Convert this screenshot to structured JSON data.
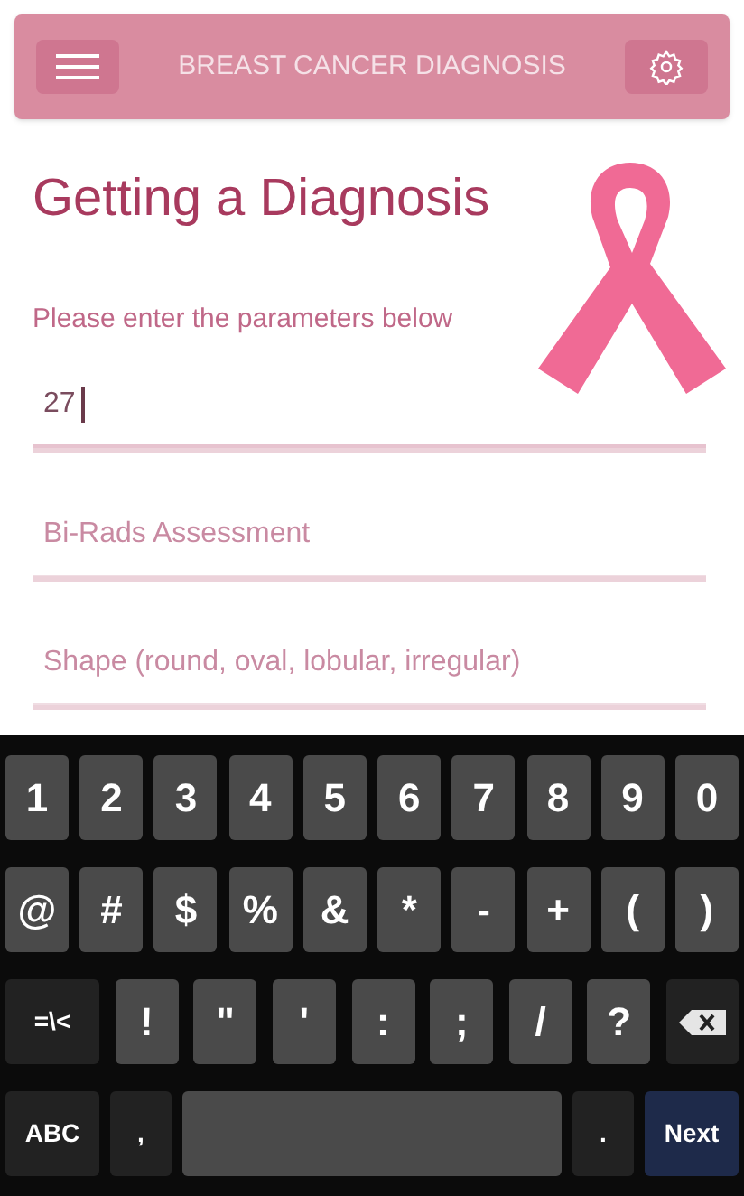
{
  "header": {
    "title": "BREAST CANCER DIAGNOSIS"
  },
  "page": {
    "heading": "Getting a Diagnosis",
    "instructions": "Please enter the parameters below"
  },
  "fields": [
    {
      "value": "27",
      "focused": true
    },
    {
      "placeholder": "Bi-Rads Assessment",
      "focused": false
    },
    {
      "placeholder": "Shape (round, oval, lobular, irregular)",
      "focused": false
    }
  ],
  "keyboard": {
    "rows": [
      {
        "keys": [
          {
            "kind": "char",
            "label": "1"
          },
          {
            "kind": "char",
            "label": "2"
          },
          {
            "kind": "char",
            "label": "3"
          },
          {
            "kind": "char",
            "label": "4"
          },
          {
            "kind": "char",
            "label": "5"
          },
          {
            "kind": "char",
            "label": "6"
          },
          {
            "kind": "char",
            "label": "7"
          },
          {
            "kind": "char",
            "label": "8"
          },
          {
            "kind": "char",
            "label": "9"
          },
          {
            "kind": "char",
            "label": "0"
          }
        ]
      },
      {
        "keys": [
          {
            "kind": "char",
            "label": "@"
          },
          {
            "kind": "char",
            "label": "#"
          },
          {
            "kind": "char",
            "label": "$"
          },
          {
            "kind": "char",
            "label": "%"
          },
          {
            "kind": "char",
            "label": "&"
          },
          {
            "kind": "char",
            "label": "*"
          },
          {
            "kind": "char",
            "label": "-"
          },
          {
            "kind": "char",
            "label": "+"
          },
          {
            "kind": "char",
            "label": "("
          },
          {
            "kind": "char",
            "label": ")"
          }
        ]
      },
      {
        "keys": [
          {
            "kind": "mod",
            "label": "=\\<"
          },
          {
            "kind": "char",
            "label": "!"
          },
          {
            "kind": "char",
            "label": "\""
          },
          {
            "kind": "char",
            "label": "'"
          },
          {
            "kind": "char",
            "label": ":"
          },
          {
            "kind": "char",
            "label": ";"
          },
          {
            "kind": "char",
            "label": "/"
          },
          {
            "kind": "char",
            "label": "?"
          },
          {
            "kind": "backspace"
          }
        ]
      },
      {
        "keys": [
          {
            "kind": "mod",
            "label": "ABC"
          },
          {
            "kind": "mod",
            "label": ","
          },
          {
            "kind": "space"
          },
          {
            "kind": "mod",
            "label": "."
          },
          {
            "kind": "action",
            "label": "Next"
          }
        ]
      }
    ]
  }
}
